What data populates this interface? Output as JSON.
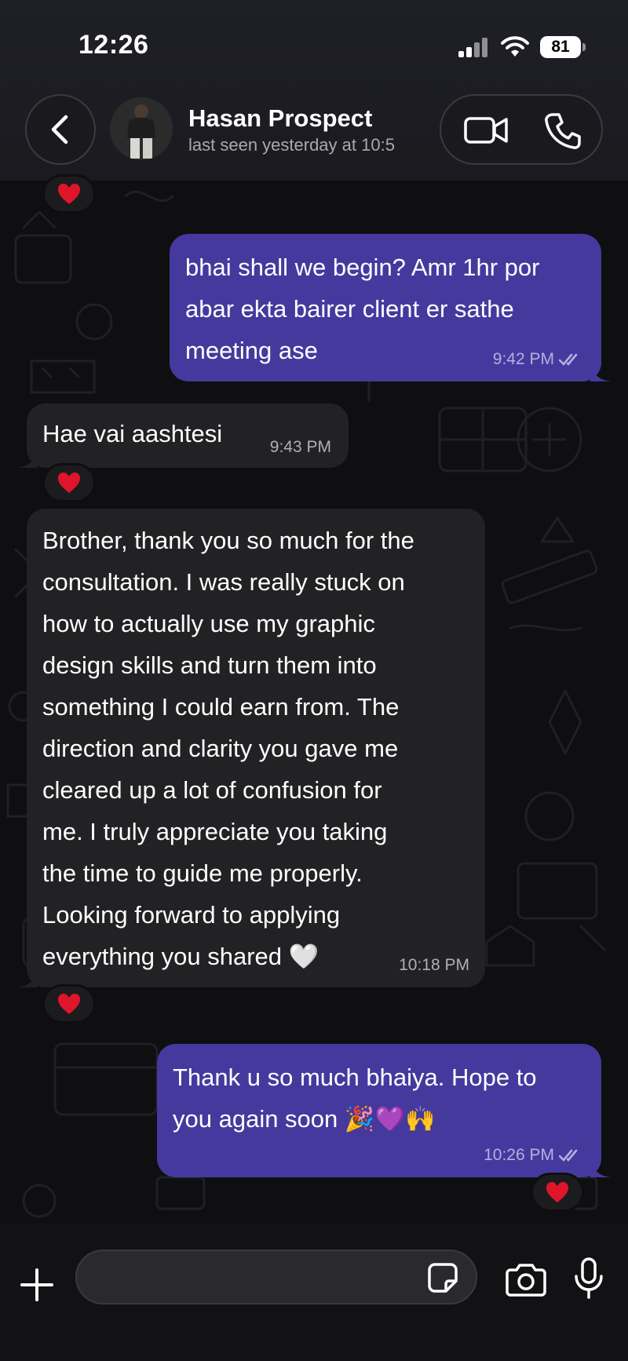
{
  "status_bar": {
    "time": "12:26",
    "battery": "81",
    "icons": [
      "cellular-signal-icon",
      "wifi-icon",
      "battery-icon"
    ]
  },
  "header": {
    "contact_name": "Hasan Prospect",
    "contact_status": "last seen yesterday at 10:5",
    "icons": [
      "back-chevron-icon",
      "video-call-icon",
      "phone-call-icon"
    ]
  },
  "messages": [
    {
      "direction": "outgoing",
      "text_lines": [
        "bhai shall we begin? Amr 1hr por",
        "abar ekta bairer client er sathe",
        "meeting ase"
      ],
      "time": "9:42 PM",
      "read": true,
      "reaction": null
    },
    {
      "direction": "incoming",
      "text_lines": [
        "Hae vai aashtesi"
      ],
      "time": "9:43 PM",
      "reaction": "❤️"
    },
    {
      "direction": "incoming",
      "text_lines": [
        "Brother, thank you so much for the",
        "consultation. I was really stuck on",
        "how to actually use my graphic",
        "design skills and turn them into",
        "something I could earn from. The",
        "direction and clarity you gave me",
        "cleared up a lot of confusion for",
        "me. I truly appreciate you taking",
        "the time to guide me properly.",
        "Looking forward to applying",
        "everything you shared 🤍"
      ],
      "time": "10:18 PM",
      "reaction": "❤️"
    },
    {
      "direction": "outgoing",
      "text_lines": [
        "Thank u so much bhaiya. Hope to",
        "you again soon 🎉💜🙌"
      ],
      "time": "10:26 PM",
      "read": true,
      "reaction": "❤️"
    }
  ],
  "top_reaction": "❤️",
  "input_bar": {
    "placeholder": "",
    "icons": [
      "plus-icon",
      "sticker-icon",
      "camera-icon",
      "microphone-icon"
    ]
  },
  "colors": {
    "outgoing_bubble": "#46399e",
    "incoming_bubble": "#222224",
    "background": "#0f0f12"
  }
}
